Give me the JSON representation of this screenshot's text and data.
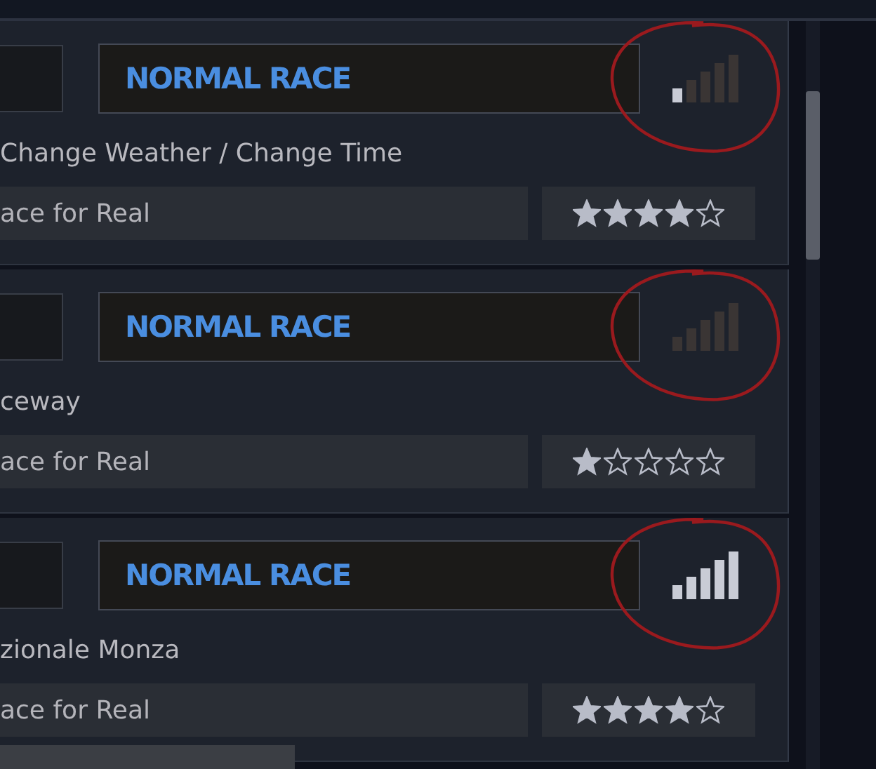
{
  "races": [
    {
      "mode": "NORMAL RACE",
      "signal_bars": [
        {
          "lit": true
        },
        {
          "lit": false
        },
        {
          "lit": false
        },
        {
          "lit": false
        },
        {
          "lit": false
        }
      ],
      "circled": true,
      "track": "Change Weather / Change Time",
      "type": "ace for Real",
      "stars": 4
    },
    {
      "mode": "NORMAL RACE",
      "signal_bars": [
        {
          "lit": false
        },
        {
          "lit": false
        },
        {
          "lit": false
        },
        {
          "lit": false
        },
        {
          "lit": false
        }
      ],
      "circled": true,
      "track": "ceway",
      "type": "ace for Real",
      "stars": 1
    },
    {
      "mode": "NORMAL RACE",
      "signal_bars": [
        {
          "lit": true
        },
        {
          "lit": true
        },
        {
          "lit": true
        },
        {
          "lit": true
        },
        {
          "lit": true
        }
      ],
      "circled": true,
      "track": "zionale Monza",
      "type": "ace for Real",
      "stars": 4
    }
  ]
}
